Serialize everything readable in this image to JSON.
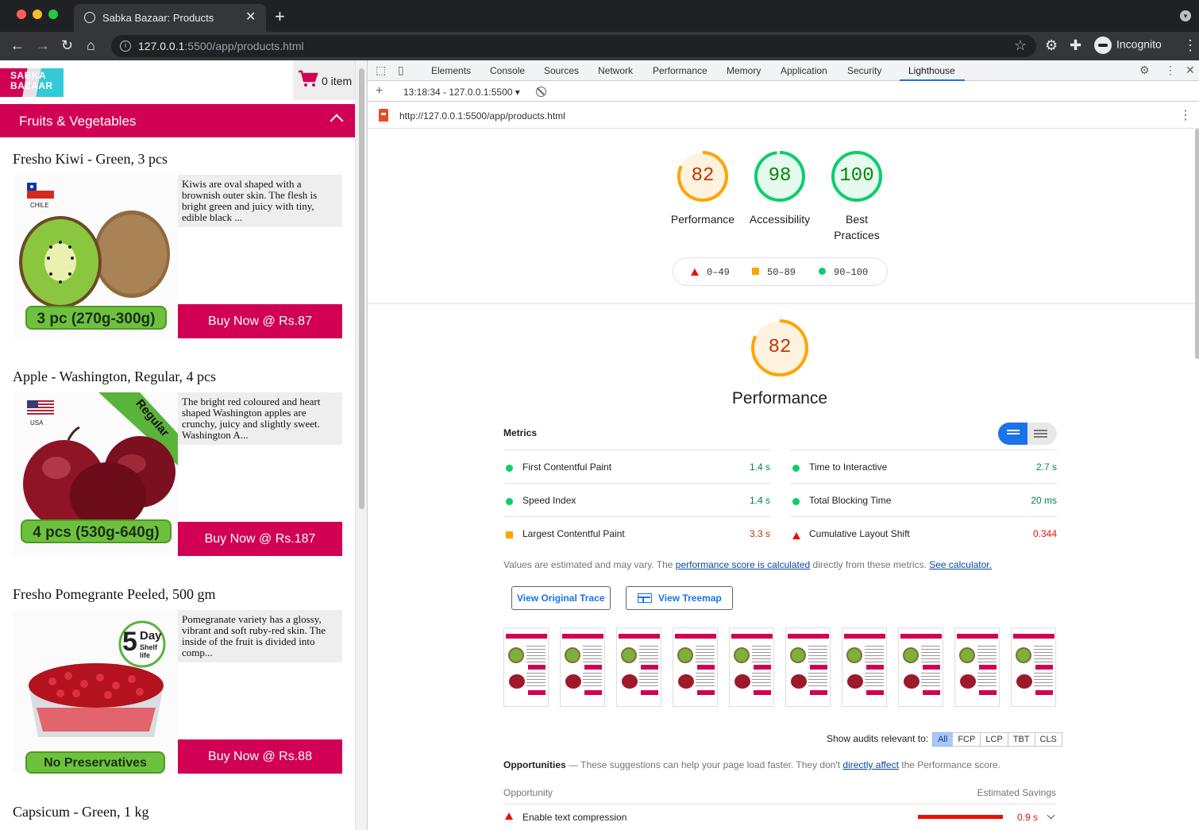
{
  "browser": {
    "tab_title": "Sabka Bazaar: Products",
    "url_host": "127.0.0.1",
    "url_rest": ":5500/app/products.html",
    "profile_label": "Incognito"
  },
  "page": {
    "logo_text": "SABKA BAZAAR",
    "cart_count": "0 item",
    "category": "Fruits & Vegetables",
    "products": [
      {
        "name": "Fresho Kiwi - Green, 3 pcs",
        "description": "Kiwis are oval shaped with a brownish outer skin. The flesh is bright green and juicy with tiny, edible black ...",
        "badge": "3 pc (270g-300g)",
        "flag_label": "CHILE",
        "buy_label": "Buy Now @ Rs.87"
      },
      {
        "name": "Apple - Washington, Regular, 4 pcs",
        "description": "The bright red coloured and heart shaped Washington apples are crunchy, juicy and slightly sweet. Washington A...",
        "badge": "4 pcs (530g-640g)",
        "flag_label": "USA",
        "ribbon": "Regular",
        "buy_label": "Buy Now @ Rs.187"
      },
      {
        "name": "Fresho Pomegrante Peeled, 500 gm",
        "description": "Pomegranate variety has a glossy, vibrant and soft ruby-red skin. The inside of the fruit is divided into comp...",
        "badge": "No Preservatives",
        "shelf_big": "5",
        "shelf_day": "Day",
        "shelf_life": "Shelf life",
        "buy_label": "Buy Now @ Rs.88"
      },
      {
        "name": "Capsicum - Green, 1 kg"
      }
    ]
  },
  "devtools": {
    "tabs": [
      "Elements",
      "Console",
      "Sources",
      "Network",
      "Performance",
      "Memory",
      "Application",
      "Security",
      "Lighthouse"
    ],
    "active_tab": "Lighthouse",
    "report_selector": "13:18:34 - 127.0.0.1:5500",
    "report_url": "http://127.0.0.1:5500/app/products.html",
    "scores": [
      {
        "label": "Performance",
        "value": "82",
        "score": 82,
        "color": "#ffa400",
        "text_color": "#c33300"
      },
      {
        "label": "Accessibility",
        "value": "98",
        "score": 98,
        "color": "#0cce6b",
        "text_color": "#008800"
      },
      {
        "label": "Best Practices",
        "value": "100",
        "score": 100,
        "color": "#0cce6b",
        "text_color": "#008800"
      }
    ],
    "legend": {
      "fail": "0–49",
      "average": "50–89",
      "pass": "90–100"
    },
    "performance": {
      "score": "82",
      "score_value": 82,
      "title": "Performance",
      "metrics_heading": "Metrics",
      "metrics_left": [
        {
          "name": "First Contentful Paint",
          "value": "1.4 s",
          "status": "pass"
        },
        {
          "name": "Speed Index",
          "value": "1.4 s",
          "status": "pass"
        },
        {
          "name": "Largest Contentful Paint",
          "value": "3.3 s",
          "status": "average"
        }
      ],
      "metrics_right": [
        {
          "name": "Time to Interactive",
          "value": "2.7 s",
          "status": "pass"
        },
        {
          "name": "Total Blocking Time",
          "value": "20 ms",
          "status": "pass"
        },
        {
          "name": "Cumulative Layout Shift",
          "value": "0.344",
          "status": "fail"
        }
      ],
      "note_pre": "Values are estimated and may vary. The ",
      "note_link1": "performance score is calculated",
      "note_mid": " directly from these metrics. ",
      "note_link2": "See calculator.",
      "btn_trace": "View Original Trace",
      "btn_treemap": "View Treemap",
      "filmstrip_count": 10,
      "filter_label": "Show audits relevant to:",
      "filters": [
        "All",
        "FCP",
        "LCP",
        "TBT",
        "CLS"
      ],
      "filter_selected": "All",
      "opp_title": "Opportunities",
      "opp_desc_pre": " — These suggestions can help your page load faster. They don't ",
      "opp_desc_link": "directly affect",
      "opp_desc_post": " the Performance score.",
      "opp_col1": "Opportunity",
      "opp_col2": "Estimated Savings",
      "opportunities": [
        {
          "name": "Enable text compression",
          "savings": "0.9 s"
        }
      ]
    }
  }
}
